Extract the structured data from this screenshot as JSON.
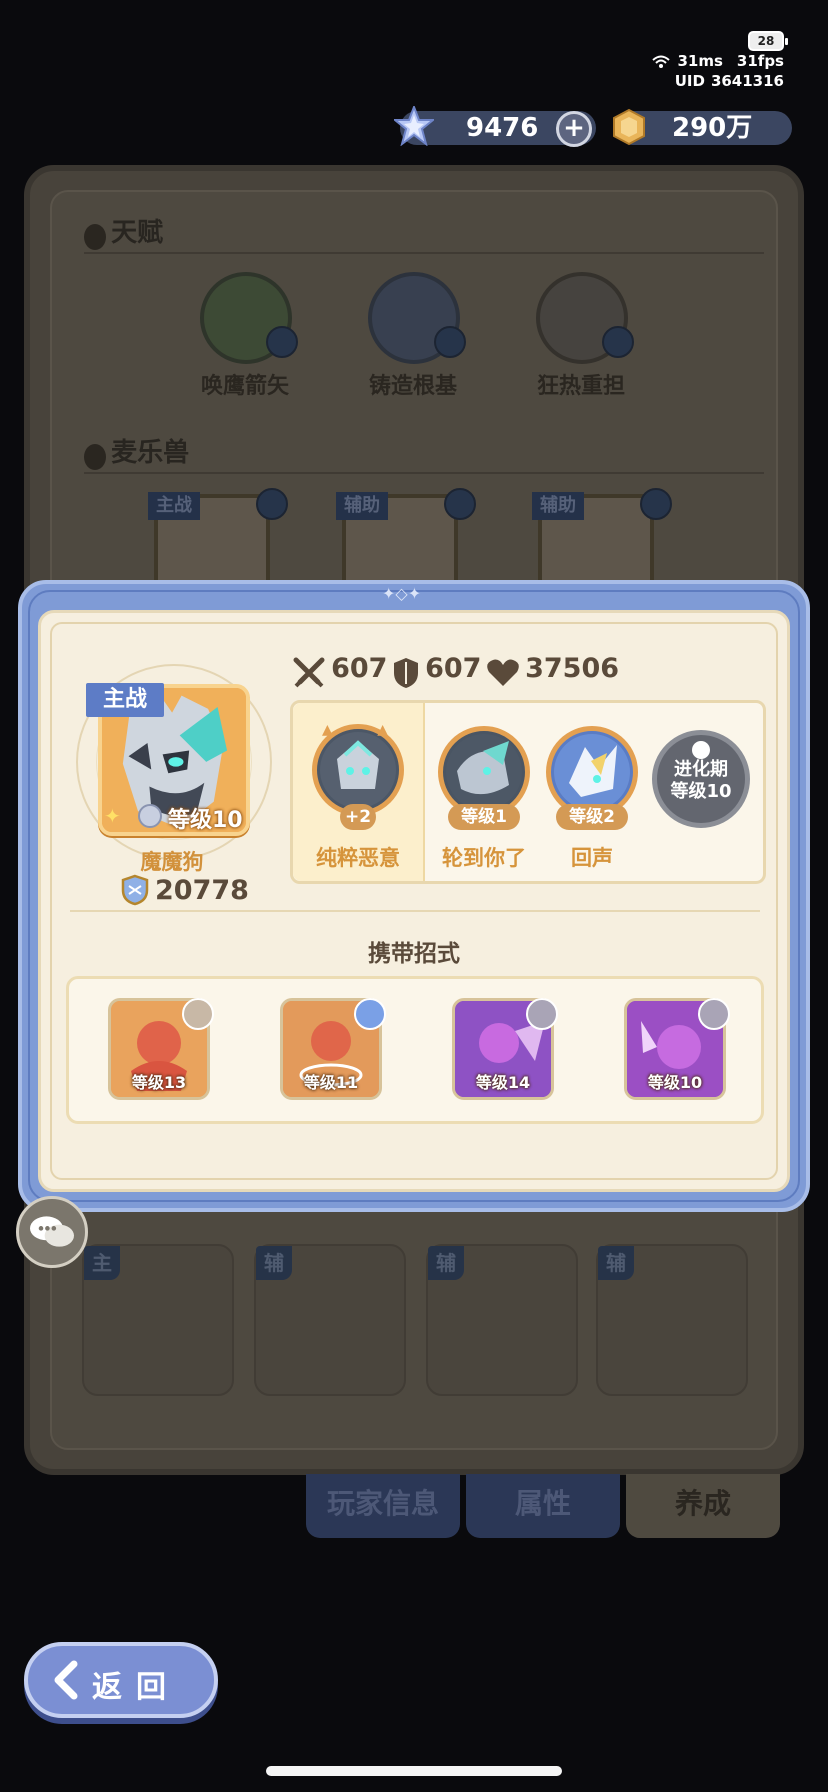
{
  "status": {
    "battery": "28",
    "ping": "31ms",
    "fps": "31fps",
    "uid_label": "UID",
    "uid": "3641316"
  },
  "resources": {
    "gems": "9476",
    "gold": "290万"
  },
  "background": {
    "talent_title": "天赋",
    "talents": [
      "唤鹰箭矢",
      "铸造根基",
      "狂热重担"
    ],
    "pets_title": "麦乐兽",
    "pet_tags": [
      "主战",
      "辅助",
      "辅助"
    ],
    "slot_tags": [
      "主",
      "辅",
      "辅",
      "辅"
    ],
    "tabs": [
      "玩家信息",
      "属性",
      "养成"
    ]
  },
  "modal": {
    "stats": {
      "attack": "607",
      "defense": "607",
      "hp": "37506"
    },
    "pet": {
      "role_tag": "主战",
      "level": "等级10",
      "name": "魔魔狗",
      "power": "20778"
    },
    "traits": [
      {
        "badge": "+2",
        "label": "纯粹恶意"
      },
      {
        "badge": "等级1",
        "label": "轮到你了"
      },
      {
        "badge": "等级2",
        "label": "回声"
      },
      {
        "locked_line1": "进化期",
        "locked_line2": "等级10"
      }
    ],
    "moves_title": "携带招式",
    "moves": [
      "等级13",
      "等级11",
      "等级14",
      "等级10"
    ]
  },
  "back_label": "返回",
  "colors": {
    "modal_frame": "#7f9bd6",
    "accent_orange": "#d6943b",
    "parchment": "#f6efdf"
  }
}
